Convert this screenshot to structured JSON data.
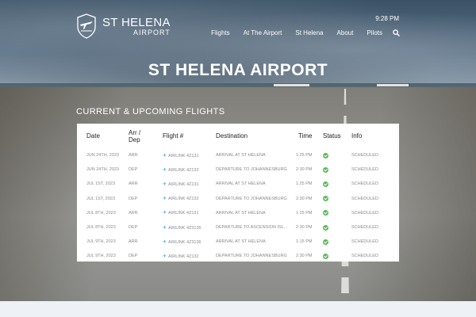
{
  "site": {
    "logo_line1": "ST HELENA",
    "logo_line2": "AIRPORT",
    "time": "9:28 PM"
  },
  "nav": {
    "items": [
      "Flights",
      "At The Airport",
      "St Helena",
      "About",
      "Pilots"
    ],
    "search_icon": "search-icon"
  },
  "hero": {
    "title": "ST HELENA AIRPORT"
  },
  "flights": {
    "section_title": "CURRENT & UPCOMING FLIGHTS",
    "headers": [
      "Date",
      "Arr / Dep",
      "Flight #",
      "Destination",
      "Time",
      "Status",
      "Info"
    ],
    "rows": [
      {
        "date": "JUN 24TH, 2023",
        "dir": "ARR",
        "flight": "AIRLINK 4Z131",
        "destination": "ARRIVAL AT ST HELENA",
        "time": "1:25 PM",
        "info": "SCHEDULED"
      },
      {
        "date": "JUN 24TH, 2023",
        "dir": "DEP",
        "flight": "AIRLINK 4Z132",
        "destination": "DEPARTURE TO JOHANNESBURG",
        "time": "2:30 PM",
        "info": "SCHEDULED"
      },
      {
        "date": "JUL 1ST, 2023",
        "dir": "ARR",
        "flight": "AIRLINK 4Z131",
        "destination": "ARRIVAL AT ST HELENA",
        "time": "1:25 PM",
        "info": "SCHEDULED"
      },
      {
        "date": "JUL 1ST, 2023",
        "dir": "DEP",
        "flight": "AIRLINK 4Z132",
        "destination": "DEPARTURE TO JOHANNESBURG",
        "time": "2:30 PM",
        "info": "SCHEDULED"
      },
      {
        "date": "JUL 8TH, 2023",
        "dir": "ARR",
        "flight": "AIRLINK 4Z131",
        "destination": "ARRIVAL AT ST HELENA",
        "time": "1:25 PM",
        "info": "SCHEDULED"
      },
      {
        "date": "JUL 8TH, 2023",
        "dir": "DEP",
        "flight": "AIRLINK 4Z3135",
        "destination": "DEPARTURE TO ASCENSION ISLAN...",
        "time": "2:30 PM",
        "info": "SCHEDULED"
      },
      {
        "date": "JUL 9TH, 2023",
        "dir": "ARR",
        "flight": "AIRLINK 4Z3136",
        "destination": "ARRIVAL AT ST HELENA",
        "time": "1:15 PM",
        "info": "SCHEDULED"
      },
      {
        "date": "JUL 9TH, 2023",
        "dir": "DEP",
        "flight": "AIRLINK 4Z132",
        "destination": "DEPARTURE TO JOHANNESBURG",
        "time": "2:30 PM",
        "info": "SCHEDULED"
      }
    ]
  },
  "colors": {
    "status_ok": "#5cb85c",
    "plane_icon": "#2aa7d7"
  }
}
